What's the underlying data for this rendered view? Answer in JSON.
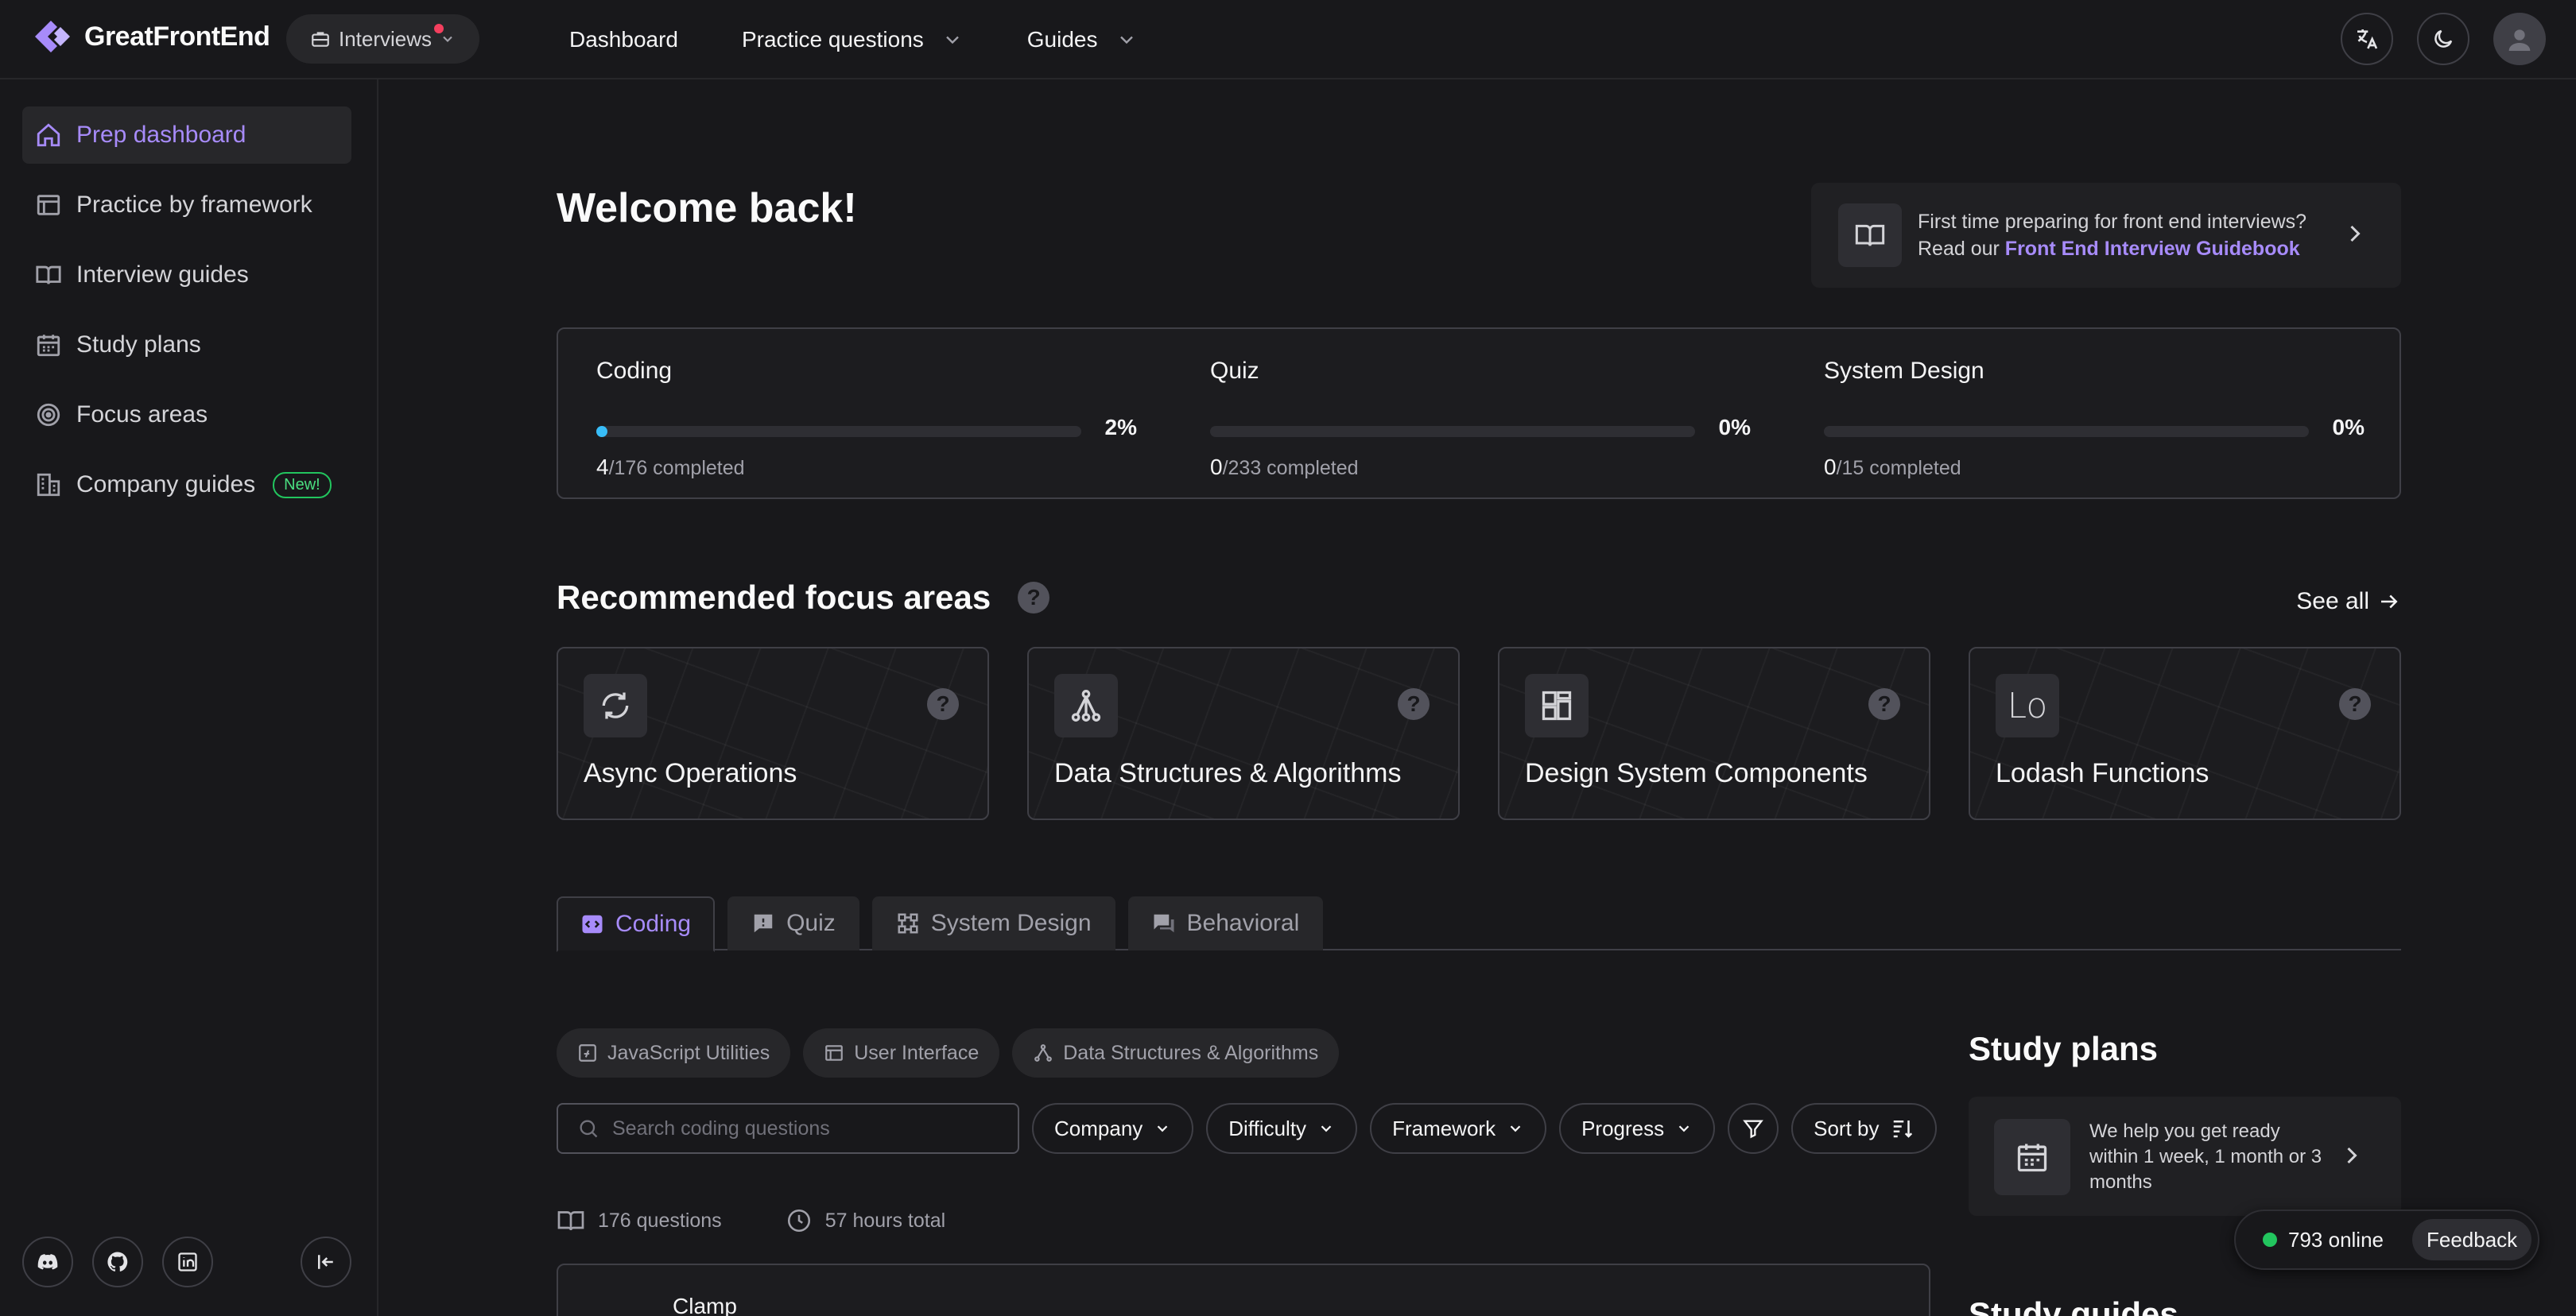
{
  "brand": {
    "name": "GreatFrontEnd",
    "accent": "#a78bfa"
  },
  "header": {
    "product_switch": "Interviews",
    "nav": [
      {
        "label": "Dashboard"
      },
      {
        "label": "Practice questions"
      },
      {
        "label": "Guides"
      }
    ]
  },
  "sidebar": {
    "items": [
      {
        "label": "Prep dashboard",
        "icon": "home-icon",
        "active": true
      },
      {
        "label": "Practice by framework",
        "icon": "browser-icon"
      },
      {
        "label": "Interview guides",
        "icon": "book-icon"
      },
      {
        "label": "Study plans",
        "icon": "calendar-icon"
      },
      {
        "label": "Focus areas",
        "icon": "target-icon"
      },
      {
        "label": "Company guides",
        "icon": "building-icon",
        "badge": "New!"
      }
    ]
  },
  "main": {
    "welcome": "Welcome back!",
    "guide_promo": {
      "line1": "First time preparing for front end interviews?",
      "line2_prefix": "Read our ",
      "link": "Front End Interview Guidebook"
    },
    "progress": [
      {
        "title": "Coding",
        "percent_text": "2%",
        "fraction": 0.02,
        "done": "4",
        "total_text": "/176 completed"
      },
      {
        "title": "Quiz",
        "percent_text": "0%",
        "fraction": 0,
        "done": "0",
        "total_text": "/233 completed"
      },
      {
        "title": "System Design",
        "percent_text": "0%",
        "fraction": 0,
        "done": "0",
        "total_text": "/15 completed"
      }
    ],
    "focus_title": "Recommended focus areas",
    "see_all": "See all",
    "focus_areas": [
      {
        "name": "Async Operations",
        "icon": "refresh-icon"
      },
      {
        "name": "Data Structures & Algorithms",
        "icon": "tree-icon"
      },
      {
        "name": "Design System Components",
        "icon": "grid-icon"
      },
      {
        "name": "Lodash Functions",
        "icon": "lodash-icon",
        "icon_text": "Lo"
      }
    ],
    "tabs": [
      {
        "label": "Coding",
        "active": true
      },
      {
        "label": "Quiz"
      },
      {
        "label": "System Design"
      },
      {
        "label": "Behavioral"
      }
    ],
    "chips": [
      {
        "label": "JavaScript Utilities"
      },
      {
        "label": "User Interface"
      },
      {
        "label": "Data Structures & Algorithms"
      }
    ],
    "search_placeholder": "Search coding questions",
    "filters": [
      {
        "label": "Company"
      },
      {
        "label": "Difficulty"
      },
      {
        "label": "Framework"
      },
      {
        "label": "Progress"
      }
    ],
    "sort_label": "Sort by",
    "stats": {
      "questions": "176 questions",
      "hours": "57 hours total"
    },
    "first_question": "Clamp"
  },
  "right": {
    "study_plans_title": "Study plans",
    "study_plans_text": "We help you get ready within 1 week, 1 month or 3 months",
    "study_guides_title": "Study guides"
  },
  "footer_widget": {
    "online": "793 online",
    "feedback": "Feedback"
  }
}
